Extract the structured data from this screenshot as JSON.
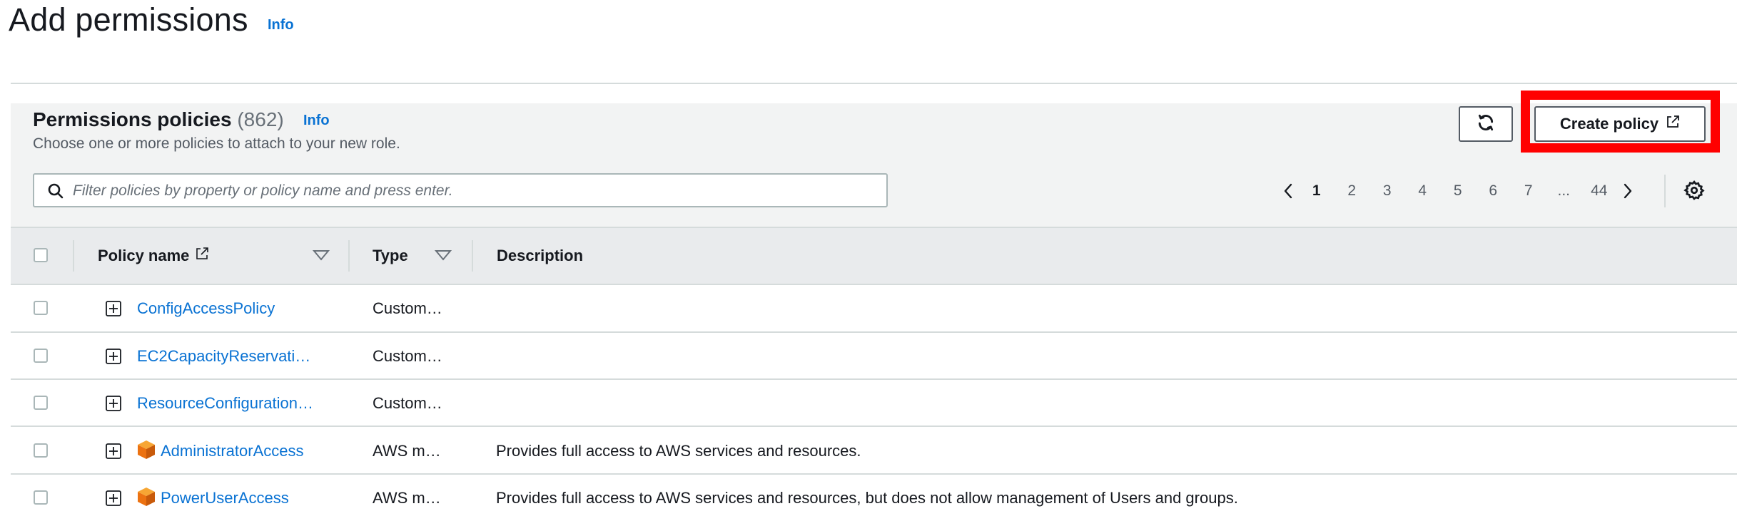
{
  "page": {
    "title": "Add permissions",
    "info_label": "Info"
  },
  "panel": {
    "title": "Permissions policies",
    "count": "(862)",
    "info_label": "Info",
    "subtitle": "Choose one or more policies to attach to your new role.",
    "create_label": "Create policy"
  },
  "search": {
    "placeholder": "Filter policies by property or policy name and press enter."
  },
  "pagination": {
    "pages": [
      "1",
      "2",
      "3",
      "4",
      "5",
      "6",
      "7",
      "...",
      "44"
    ],
    "current": "1"
  },
  "table": {
    "headers": {
      "policy_name": "Policy name",
      "type": "Type",
      "description": "Description"
    },
    "rows": [
      {
        "name": "ConfigAccessPolicy",
        "type": "Custom…",
        "description": "",
        "icon": "none"
      },
      {
        "name": "EC2CapacityReservati…",
        "type": "Custom…",
        "description": "",
        "icon": "none"
      },
      {
        "name": "ResourceConfiguration…",
        "type": "Custom…",
        "description": "",
        "icon": "none"
      },
      {
        "name": "AdministratorAccess",
        "type": "AWS m…",
        "description": "Provides full access to AWS services and resources.",
        "icon": "aws-managed-cube-icon"
      },
      {
        "name": "PowerUserAccess",
        "type": "AWS m…",
        "description": "Provides full access to AWS services and resources, but does not allow management of Users and groups.",
        "icon": "aws-managed-cube-icon"
      }
    ]
  },
  "colors": {
    "link": "#0972d3",
    "highlight": "#ff0000",
    "aws_cube": "#ec7211"
  }
}
